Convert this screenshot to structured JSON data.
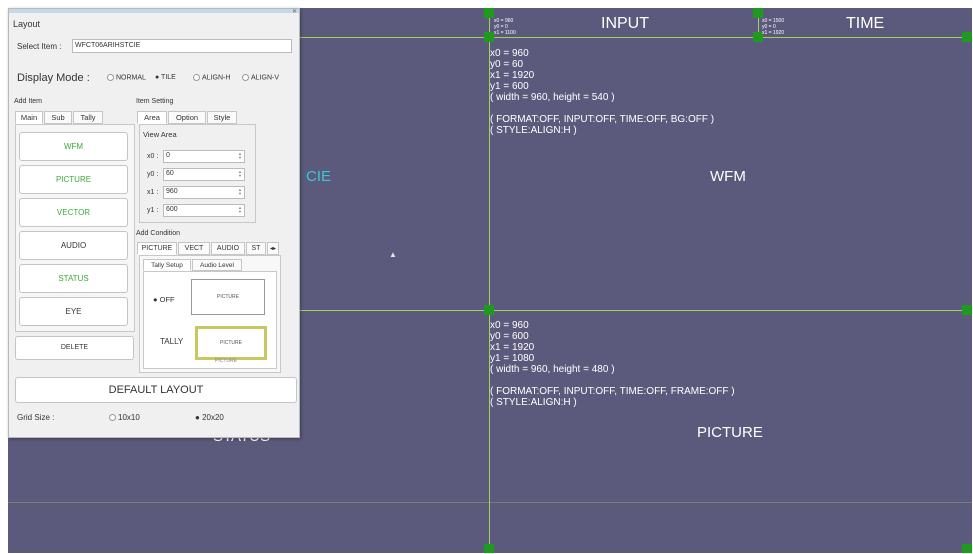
{
  "dialog": {
    "title": "Layout",
    "select_item_label": "Select Item :",
    "select_item_value": "WFCT06ARIHSTCIE",
    "display_mode": {
      "label": "Display Mode :",
      "options": [
        "NORMAL",
        "TILE",
        "ALIGN-H",
        "ALIGN-V"
      ],
      "selected": "TILE"
    },
    "add_item": {
      "title": "Add Item",
      "tabs": [
        "Main",
        "Sub",
        "Tally"
      ],
      "buttons": [
        "WFM",
        "PICTURE",
        "VECTOR",
        "AUDIO",
        "STATUS",
        "EYE"
      ],
      "delete_label": "DELETE"
    },
    "item_setting": {
      "title": "Item Setting",
      "tabs": [
        "Area",
        "Option",
        "Style"
      ],
      "view_area_title": "View Area",
      "fields": [
        {
          "label": "x0 :",
          "value": "0"
        },
        {
          "label": "y0 :",
          "value": "60"
        },
        {
          "label": "x1 :",
          "value": "960"
        },
        {
          "label": "y1 :",
          "value": "600"
        }
      ]
    },
    "add_condition": {
      "title": "Add Condition",
      "tabs": [
        "PICTURE",
        "VECT",
        "AUDIO",
        "ST"
      ],
      "tab_arrows": "◂▸",
      "subtabs": [
        "Tally Setup",
        "Audio Level"
      ],
      "off_label": "OFF",
      "off_preview": "PICTURE",
      "tally_label": "TALLY",
      "tally_preview": "PICTURE",
      "tally_preview_caption": "PICTURE"
    },
    "default_layout_label": "DEFAULT LAYOUT",
    "grid_size": {
      "label": "Grid Size :",
      "options": [
        "10x10",
        "20x20"
      ],
      "selected": "20x20"
    }
  },
  "canvas": {
    "headers": {
      "input": "INPUT",
      "time": "TIME"
    },
    "input_coords": "x0 = 960\ny0 = 0\nx1 = 1100",
    "time_coords": "x0 = 1500\ny0 = 0\nx1 = 1920",
    "wfm_info": "x0 = 960\ny0 = 60\nx1 = 1920\ny1 = 600\n( width = 960, height = 540 )\n\n( FORMAT:OFF, INPUT:OFF, TIME:OFF, BG:OFF )\n( STYLE:ALIGN:H )",
    "wfm_label": "WFM",
    "picture_info": "x0 = 960\ny0 = 600\nx1 = 1920\ny1 = 1080\n( width = 960, height = 480 )\n\n( FORMAT:OFF, INPUT:OFF, TIME:OFF, FRAME:OFF )\n( STYLE:ALIGN:H )",
    "picture_label": "PICTURE",
    "left_partial_label": "CIE",
    "status_partial_label": "STATUS"
  },
  "colors": {
    "canvas_bg": "#5c5a7c",
    "grid_line": "#9fd35a",
    "handle": "#1f9a1f",
    "green_button_text": "#3caa3c",
    "tally_highlight": "#c8c860",
    "vector_text": "#3ac8d0"
  },
  "icons": {
    "close": "close-icon",
    "cursor": "mouse-cursor-icon",
    "spinner": "spinner-arrows-icon"
  }
}
